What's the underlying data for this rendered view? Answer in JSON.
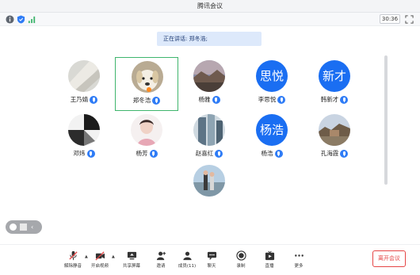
{
  "app": {
    "title": "腾讯会议"
  },
  "infobar": {
    "timer": "30:36"
  },
  "speaking": {
    "text": "正在讲话: 郑冬浩;"
  },
  "participants": [
    {
      "name": "王乃婧",
      "avatar": "photo"
    },
    {
      "name": "郑冬浩",
      "avatar": "photo",
      "active": true
    },
    {
      "name": "杨雅",
      "avatar": "photo"
    },
    {
      "name": "李思悦",
      "avatar": "text",
      "avatar_text": "思悦"
    },
    {
      "name": "韩新才",
      "avatar": "text",
      "avatar_text": "新才"
    },
    {
      "name": "邓炜",
      "avatar": "photo"
    },
    {
      "name": "杨芳",
      "avatar": "photo"
    },
    {
      "name": "赵喜红",
      "avatar": "photo"
    },
    {
      "name": "杨浩",
      "avatar": "text",
      "avatar_text": "杨浩"
    },
    {
      "name": "孔海霞",
      "avatar": "photo"
    },
    {
      "name": "",
      "avatar": "photo"
    }
  ],
  "toolbar": {
    "mute": "解除静音",
    "video": "开启视频",
    "share": "共享屏幕",
    "invite": "邀请",
    "members": "成员(11)",
    "chat": "聊天",
    "record": "录制",
    "live": "直播",
    "more": "更多",
    "leave": "离开会议"
  },
  "colors": {
    "accent": "#2f7cf6",
    "active_border": "#3fb56d",
    "leave": "#e54545",
    "text_avatar": "#1a6ef2"
  }
}
